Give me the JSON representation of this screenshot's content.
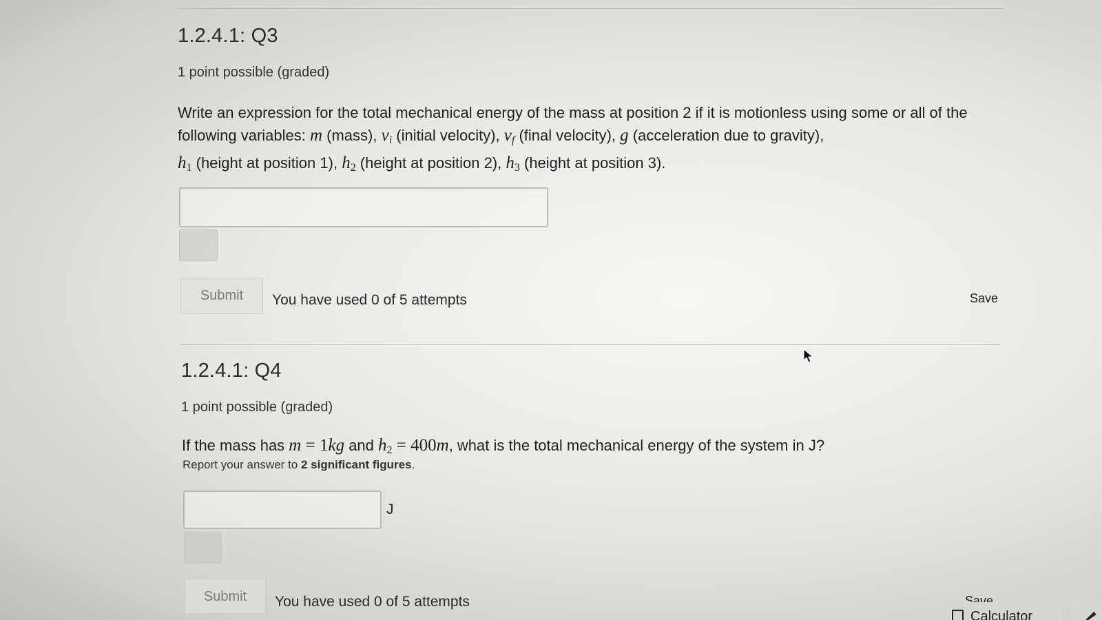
{
  "q3": {
    "title": "1.2.4.1: Q3",
    "points": "1 point possible (graded)",
    "question": {
      "intro": "Write an expression for the total mechanical energy of the mass at position 2 if it is motionless using some or all of the following variables: ",
      "m_sym": "m",
      "m_desc": " (mass), ",
      "vi_sym": "v",
      "vi_sub": "i",
      "vi_desc": " (initial velocity), ",
      "vf_sym": "v",
      "vf_sub": "f",
      "vf_desc": " (final velocity), ",
      "g_sym": "g",
      "g_desc": " (acceleration due to gravity),",
      "h1_sym": "h",
      "h1_sub": "1",
      "h1_desc": " (height at position 1), ",
      "h2_sym": "h",
      "h2_sub": "2",
      "h2_desc": " (height at position 2), ",
      "h3_sym": "h",
      "h3_sub": "3",
      "h3_desc": " (height at position 3)."
    },
    "answer_value": "",
    "submit_label": "Submit",
    "attempts_text": "You have used 0 of 5 attempts",
    "save_label": "Save"
  },
  "q4": {
    "title": "1.2.4.1: Q4",
    "points": "1 point possible (graded)",
    "question": {
      "intro": "If the mass has ",
      "m_sym": "m",
      "eq1": " = ",
      "m_val": "1",
      "m_unit": "kg",
      "mid": " and ",
      "h2_sym": "h",
      "h2_sub": "2",
      "eq2": " = ",
      "h2_val": "400",
      "h2_unit": "m",
      "outro": ", what is the total mechanical energy of the system in J?"
    },
    "hint_prefix": "Report your answer to ",
    "hint_bold": "2 significant figures",
    "hint_suffix": ".",
    "answer_value": "",
    "unit_label": "J",
    "submit_label": "Submit",
    "attempts_text": "You have used 0 of 5 attempts",
    "save_label": "Save"
  },
  "toolbar": {
    "calculator_label": "Calculator"
  }
}
